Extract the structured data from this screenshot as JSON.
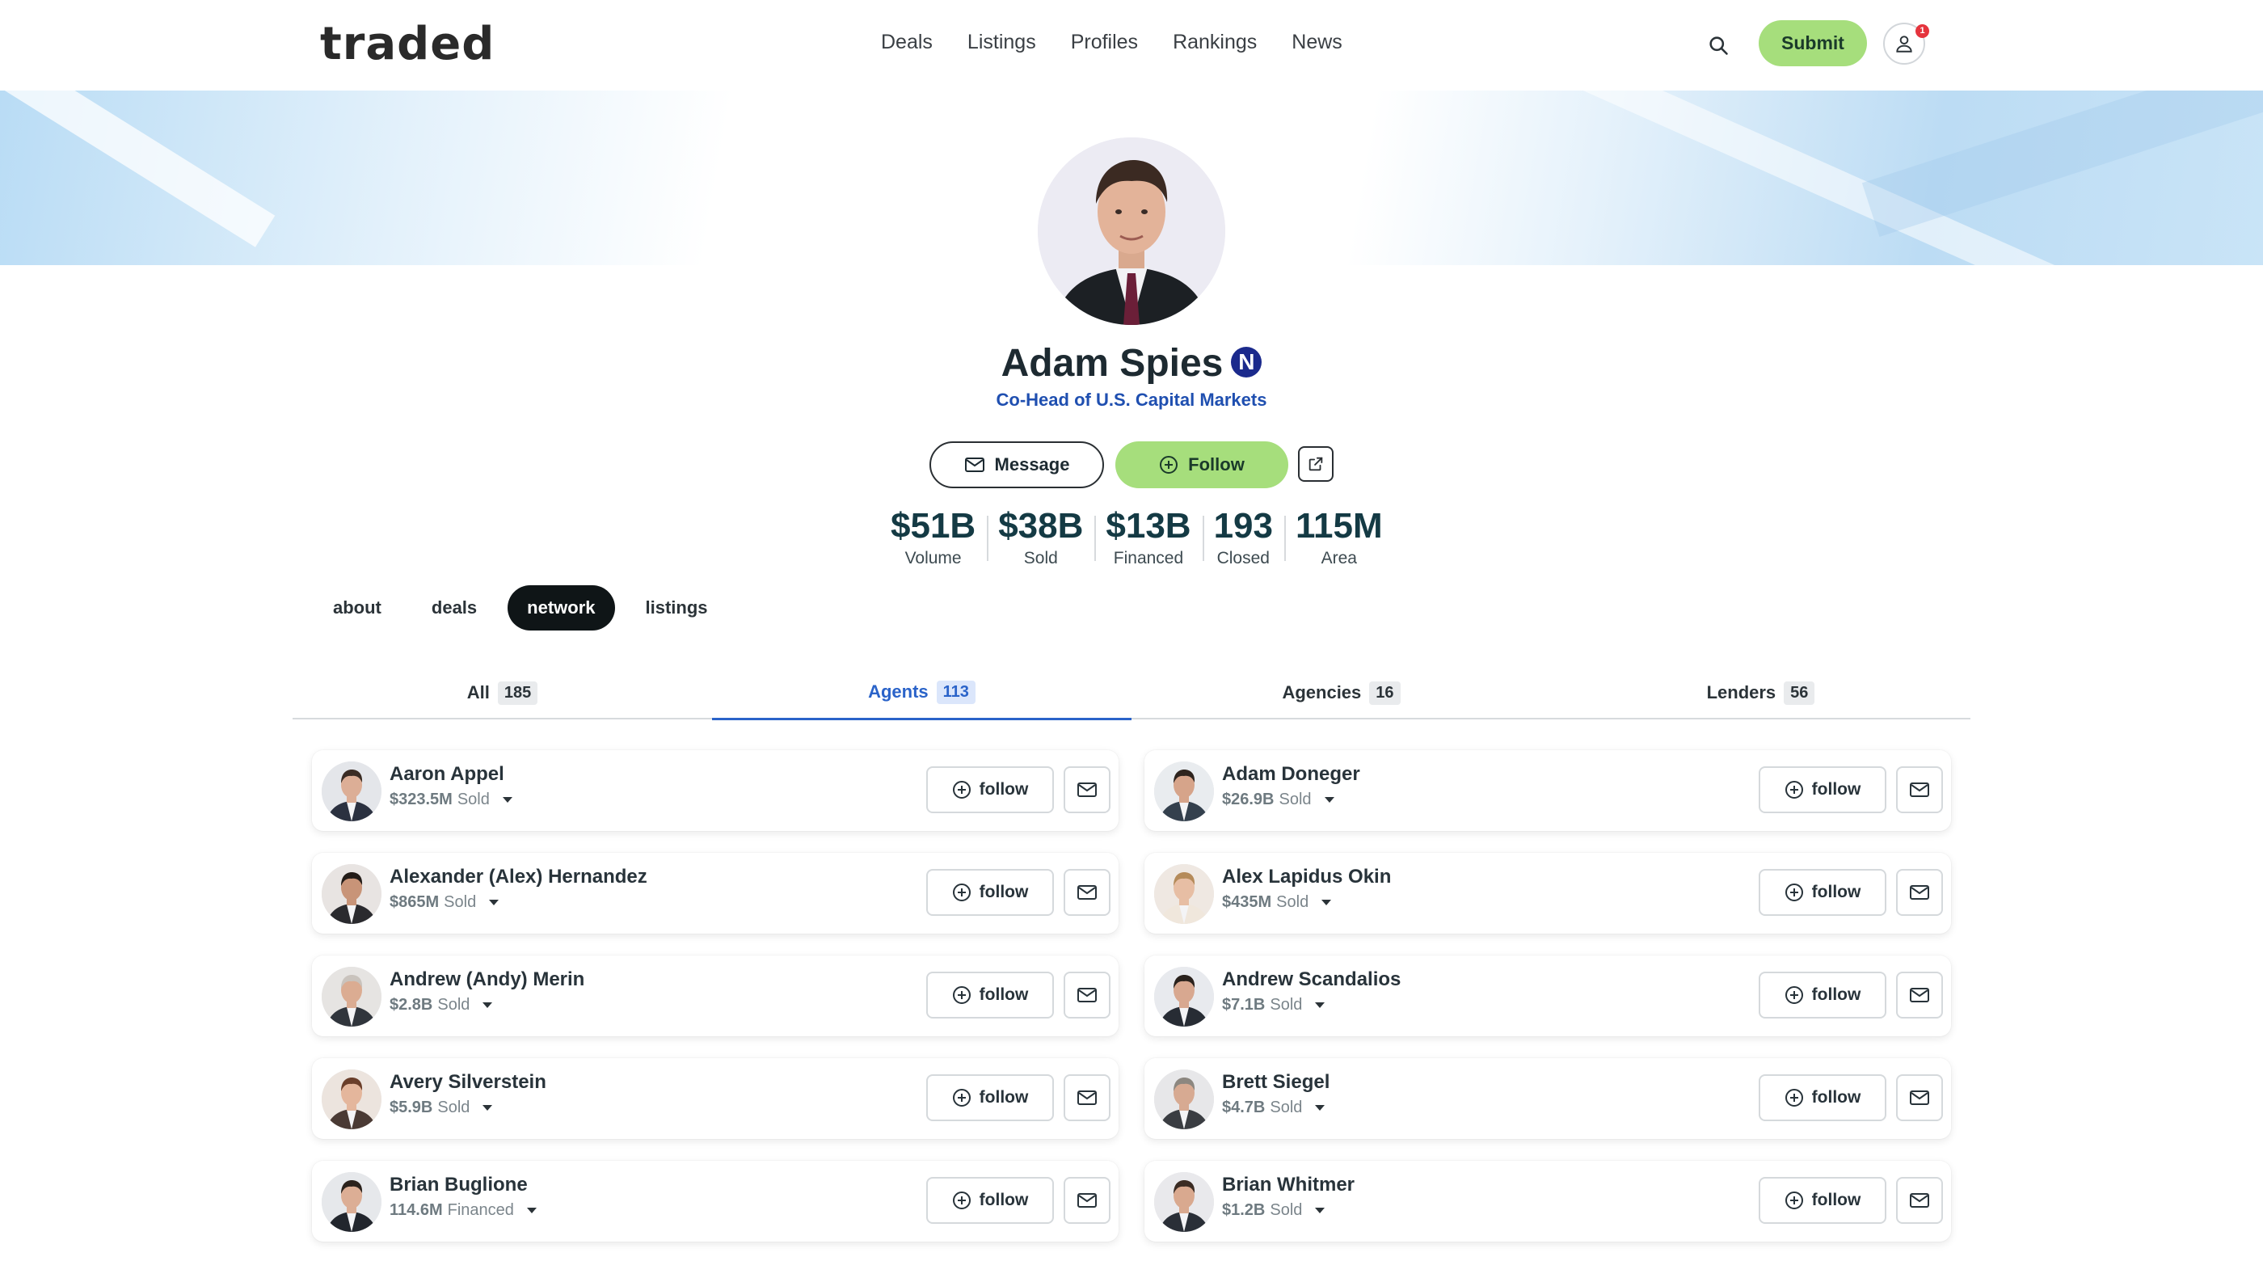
{
  "header": {
    "logo": "traded",
    "nav": [
      "Deals",
      "Listings",
      "Profiles",
      "Rankings",
      "News"
    ],
    "submit_label": "Submit",
    "notification_count": "1"
  },
  "profile": {
    "name": "Adam Spies",
    "badge": "N",
    "title": "Co-Head of U.S. Capital Markets",
    "message_label": "Message",
    "follow_label": "Follow",
    "stats": [
      {
        "value": "$51B",
        "label": "Volume"
      },
      {
        "value": "$38B",
        "label": "Sold"
      },
      {
        "value": "$13B",
        "label": "Financed"
      },
      {
        "value": "193",
        "label": "Closed"
      },
      {
        "value": "115M",
        "label": "Area"
      }
    ]
  },
  "tabs": {
    "items": [
      "about",
      "deals",
      "network",
      "listings"
    ],
    "active": "network"
  },
  "network": {
    "subtabs": [
      {
        "label": "All",
        "count": "185"
      },
      {
        "label": "Agents",
        "count": "113"
      },
      {
        "label": "Agencies",
        "count": "16"
      },
      {
        "label": "Lenders",
        "count": "56"
      }
    ],
    "active_subtab": "Agents",
    "follow_label": "follow",
    "cards": [
      {
        "name": "Aaron Appel",
        "amount": "$323.5M",
        "kind": "Sold"
      },
      {
        "name": "Adam Doneger",
        "amount": "$26.9B",
        "kind": "Sold"
      },
      {
        "name": "Alexander (Alex) Hernandez",
        "amount": "$865M",
        "kind": "Sold"
      },
      {
        "name": "Alex Lapidus Okin",
        "amount": "$435M",
        "kind": "Sold"
      },
      {
        "name": "Andrew (Andy) Merin",
        "amount": "$2.8B",
        "kind": "Sold"
      },
      {
        "name": "Andrew Scandalios",
        "amount": "$7.1B",
        "kind": "Sold"
      },
      {
        "name": "Avery Silverstein",
        "amount": "$5.9B",
        "kind": "Sold"
      },
      {
        "name": "Brett Siegel",
        "amount": "$4.7B",
        "kind": "Sold"
      },
      {
        "name": "Brian Buglione",
        "amount": "114.6M",
        "kind": "Financed"
      },
      {
        "name": "Brian Whitmer",
        "amount": "$1.2B",
        "kind": "Sold"
      }
    ]
  },
  "colors": {
    "accent_green": "#a6de7c",
    "active_tab_blue": "#2a63c9",
    "title_blue": "#1f4fb0",
    "badge_navy": "#1b2a8c"
  }
}
